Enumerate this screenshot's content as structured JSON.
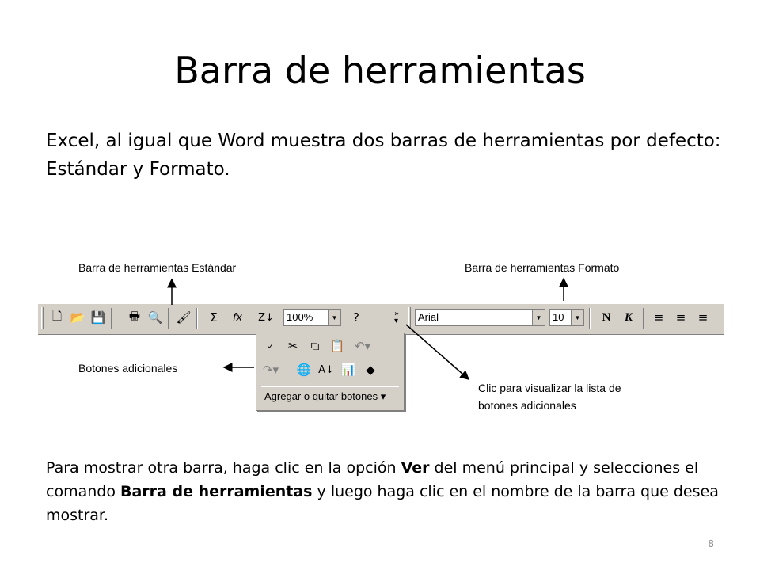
{
  "slide": {
    "title": "Barra de herramientas",
    "intro": "Excel, al igual que Word muestra dos barras de herramientas por defecto: Estándar y Formato.",
    "outro": {
      "part1": "Para mostrar otra barra, haga clic en la opción ",
      "bold1": "Ver",
      "part2": " del menú principal y selecciones el comando ",
      "bold2": "Barra de herramientas",
      "part3": " y luego haga clic en el nombre de la barra que desea mostrar."
    },
    "page_number": "8"
  },
  "callouts": {
    "standard": "Barra de herramientas Estándar",
    "format": "Barra de herramientas Formato",
    "additional": "Botones adicionales",
    "more_line1": "Clic para visualizar la lista de",
    "more_line2": "botones adicionales"
  },
  "toolbar": {
    "zoom_value": "100%",
    "font_value": "Arial",
    "size_value": "10",
    "bold_label": "N",
    "italic_label": "K",
    "icons": [
      "new-icon",
      "open-icon",
      "save-icon",
      "print-icon",
      "print-preview-icon",
      "format-painter-icon",
      "autosum-icon",
      "function-icon",
      "sort-descending-icon",
      "help-icon",
      "more-buttons-icon",
      "align-left-icon",
      "center-icon",
      "align-right-icon"
    ]
  },
  "dropdown": {
    "command_label_underlined": "A",
    "command_label_rest": "gregar o quitar botones",
    "icons": [
      "spelling-icon",
      "cut-icon",
      "copy-icon",
      "paste-icon",
      "undo-icon",
      "redo-icon",
      "hyperlink-icon",
      "sort-ascending-icon",
      "chart-wizard-icon",
      "drawing-icon"
    ]
  }
}
